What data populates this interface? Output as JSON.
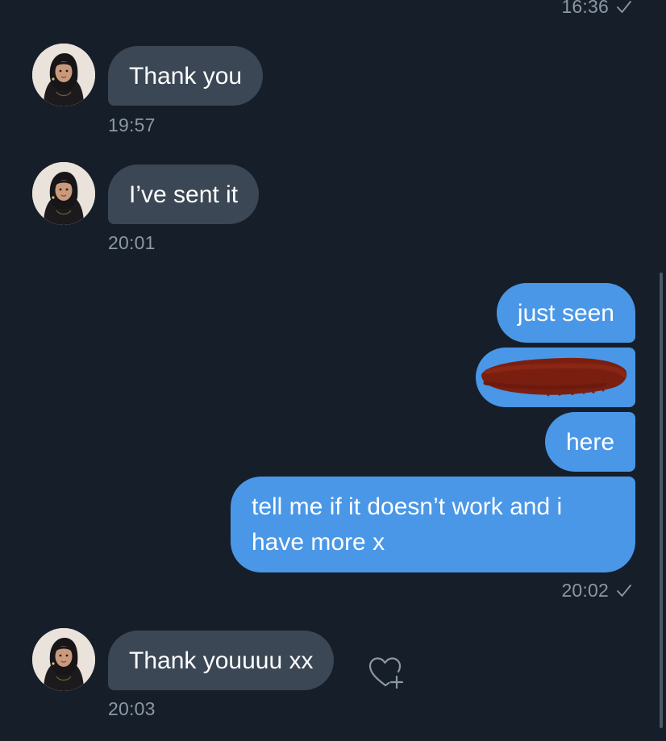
{
  "conversation": {
    "messages": [
      {
        "direction": "incoming",
        "text": "Thank you",
        "time": "19:57"
      },
      {
        "direction": "incoming",
        "text": "I’ve sent it",
        "time": "20:01"
      },
      {
        "direction": "outgoing",
        "text": "just seen"
      },
      {
        "direction": "outgoing",
        "text": "",
        "redacted": true
      },
      {
        "direction": "outgoing",
        "text": "here"
      },
      {
        "direction": "outgoing",
        "text": "tell me if it doesn’t work and i have more x",
        "time": "20:02",
        "status": "sent"
      },
      {
        "direction": "incoming",
        "text": "Thank youuuu xx",
        "time": "20:03"
      }
    ],
    "previous_timestamp": "16:36"
  },
  "icons": {
    "sent_status": "checkmark-icon",
    "react": "heart-plus-icon"
  },
  "colors": {
    "background": "#161e29",
    "incoming_bubble": "#3b4755",
    "outgoing_bubble": "#4a97e7",
    "timestamp": "#8b98a5",
    "redaction": "#7a1f10"
  }
}
